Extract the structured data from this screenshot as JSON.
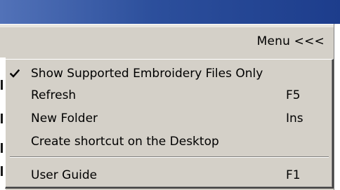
{
  "toolbar": {
    "menu_label": "Menu <<<"
  },
  "menu": {
    "items": [
      {
        "label": "Show Supported Embroidery Files Only",
        "shortcut": "",
        "checked": true
      },
      {
        "label": "Refresh",
        "shortcut": "F5",
        "checked": false
      },
      {
        "label": "New Folder",
        "shortcut": "Ins",
        "checked": false
      },
      {
        "label": "Create shortcut on the Desktop",
        "shortcut": "",
        "checked": false
      },
      {
        "label": "User Guide",
        "shortcut": "F1",
        "checked": false
      }
    ]
  },
  "colors": {
    "titlebar": "#2c4f9c",
    "menu_background": "#d4d0c8"
  },
  "icons": {
    "check": "check-icon"
  }
}
